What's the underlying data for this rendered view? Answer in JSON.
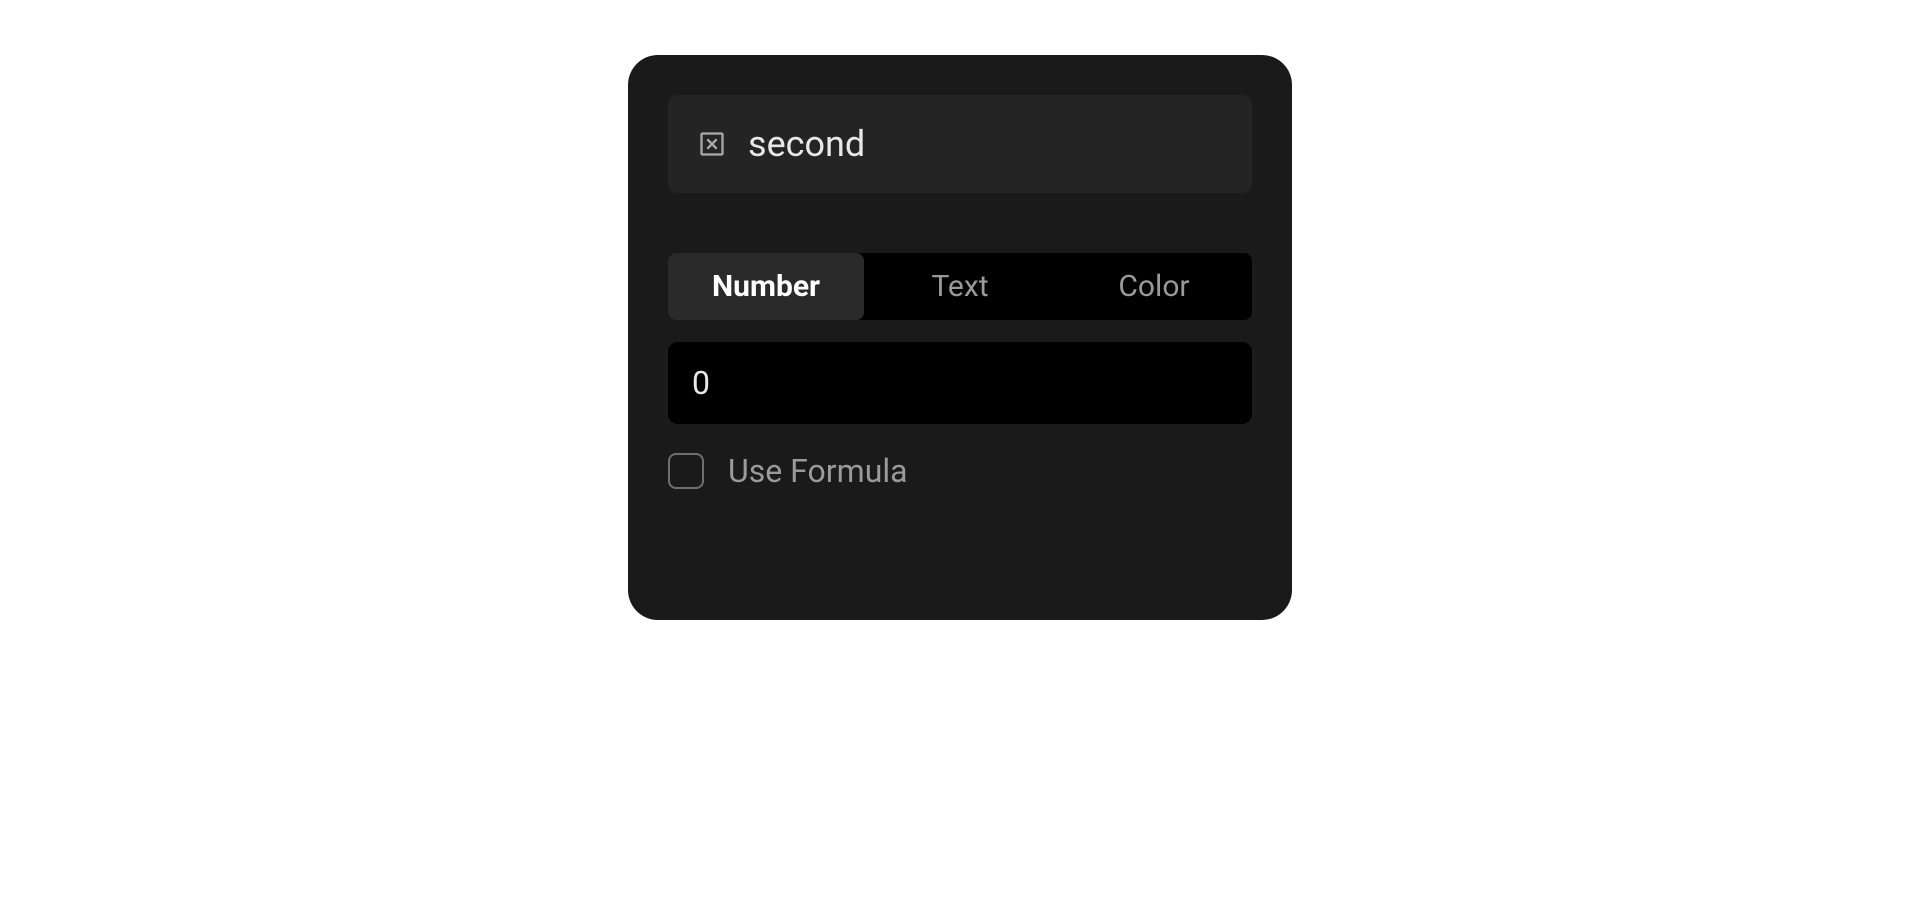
{
  "field": {
    "name": "second",
    "value": "0"
  },
  "tabs": {
    "number": "Number",
    "text": "Text",
    "color": "Color"
  },
  "formula": {
    "label": "Use Formula",
    "checked": false
  }
}
